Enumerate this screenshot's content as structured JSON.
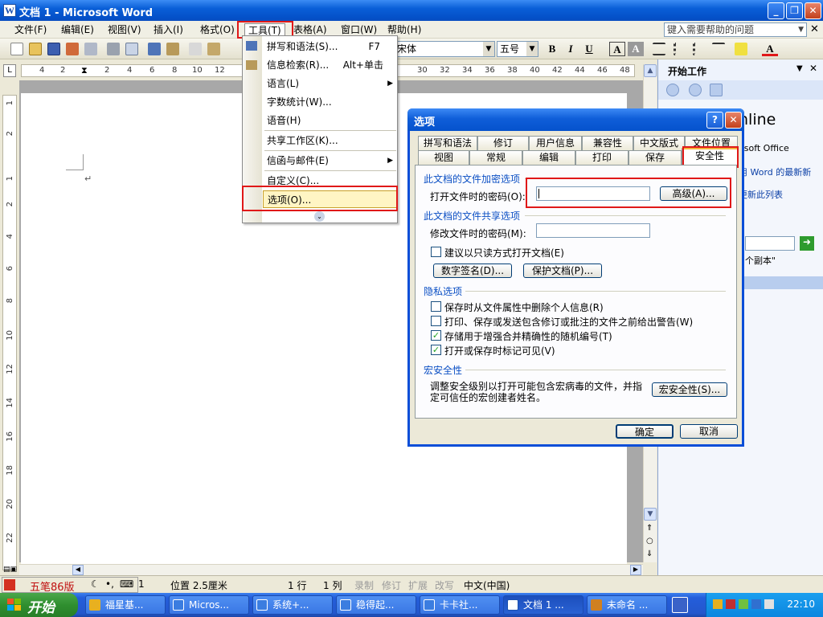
{
  "window": {
    "title": "文档 1 - Microsoft Word"
  },
  "menubar": {
    "items": [
      "文件(F)",
      "编辑(E)",
      "视图(V)",
      "插入(I)",
      "格式(O)",
      "工具(T)",
      "表格(A)",
      "窗口(W)",
      "帮助(H)"
    ],
    "help_placeholder": "键入需要帮助的问题"
  },
  "toolbar": {
    "font_name": "宋体",
    "font_size": "五号",
    "bold": "B",
    "italic": "I",
    "underline": "U",
    "char_border": "A",
    "char_shading": "A",
    "font_color": "A"
  },
  "ruler": {
    "h": [
      "4",
      "2",
      "2",
      "4",
      "6",
      "8",
      "10",
      "12",
      "30",
      "32",
      "34",
      "36",
      "38",
      "40",
      "42",
      "44",
      "46",
      "48"
    ],
    "v": [
      "1",
      "2",
      "1",
      "2",
      "4",
      "6",
      "8",
      "10",
      "12",
      "14",
      "16",
      "18",
      "20",
      "22"
    ]
  },
  "tools_menu": {
    "items": [
      {
        "label": "拼写和语法(S)...",
        "shortcut": "F7"
      },
      {
        "label": "信息检索(R)...",
        "shortcut": "Alt+单击"
      },
      {
        "label": "语言(L)",
        "shortcut": ""
      },
      {
        "label": "字数统计(W)...",
        "shortcut": ""
      },
      {
        "label": "语音(H)",
        "shortcut": ""
      },
      {
        "label": "共享工作区(K)...",
        "shortcut": ""
      },
      {
        "label": "信函与邮件(E)",
        "shortcut": ""
      },
      {
        "label": "自定义(C)...",
        "shortcut": ""
      },
      {
        "label": "选项(O)...",
        "shortcut": ""
      }
    ]
  },
  "dialog": {
    "title": "选项",
    "tabs_row1": [
      "拼写和语法",
      "修订",
      "用户信息",
      "兼容性",
      "中文版式",
      "文件位置"
    ],
    "tabs_row2": [
      "视图",
      "常规",
      "编辑",
      "打印",
      "保存",
      "安全性"
    ],
    "encrypt_group": "此文档的文件加密选项",
    "open_password_label": "打开文件时的密码(O):",
    "open_password_value": "",
    "advanced_button": "高级(A)...",
    "share_group": "此文档的文件共享选项",
    "modify_password_label": "修改文件时的密码(M):",
    "modify_password_value": "",
    "readonly_label": "建议以只读方式打开文档(E)",
    "digital_signature_button": "数字签名(D)...",
    "protect_document_button": "保护文档(P)...",
    "privacy_group": "隐私选项",
    "privacy_options": [
      {
        "label": "保存时从文件属性中删除个人信息(R)",
        "checked": false
      },
      {
        "label": "打印、保存或发送包含修订或批注的文件之前给出警告(W)",
        "checked": false
      },
      {
        "label": "存储用于增强合并精确性的随机编号(T)",
        "checked": true
      },
      {
        "label": "打开或保存时标记可见(V)",
        "checked": true
      }
    ],
    "macro_group": "宏安全性",
    "macro_text_line1": "调整安全级别以打开可能包含宏病毒的文件，并指",
    "macro_text_line2": "定可信任的宏创建者姓名。",
    "macro_button": "宏安全性(S)...",
    "ok_button": "确定",
    "cancel_button": "取消"
  },
  "task_pane": {
    "title": "开始工作",
    "visible_lines": [
      "nline",
      "osoft Office",
      "用 Word 的最新新",
      "更新此列表",
      "个副本\""
    ]
  },
  "statusbar": {
    "ime_label": "五笔86版",
    "page_frag": "1",
    "position": "位置 2.5厘米",
    "line": "1 行",
    "column": "1 列",
    "rec": "录制",
    "trk": "修订",
    "ext": "扩展",
    "ovr": "改写",
    "language": "中文(中国)"
  },
  "taskbar": {
    "start_label": "开始",
    "tasks": [
      "福星基...",
      "Micros...",
      "系统+...",
      "稳得起...",
      "卡卡社...",
      "文档 1 ...",
      "未命名 ..."
    ],
    "clock": "22:10"
  }
}
